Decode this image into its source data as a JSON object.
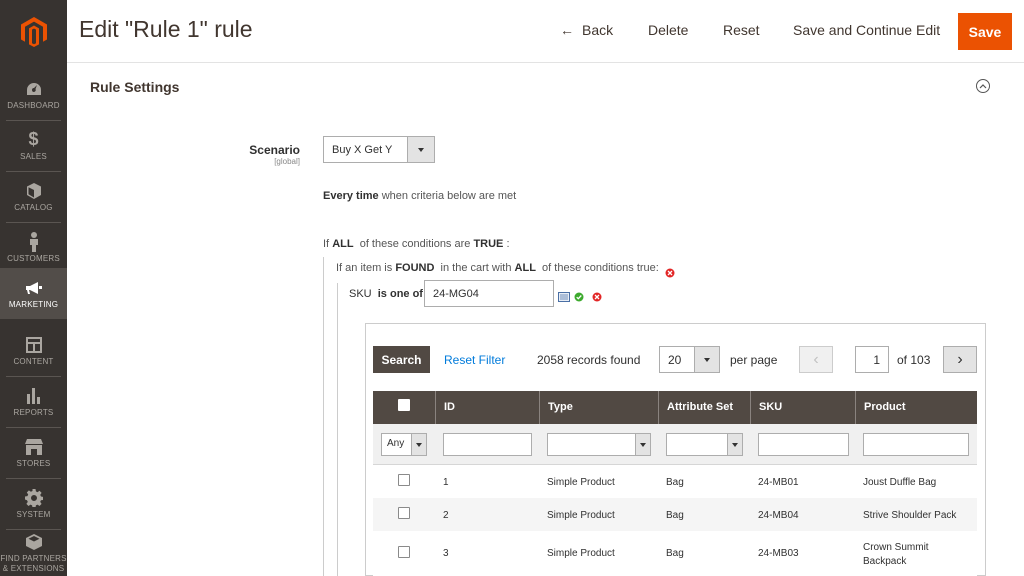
{
  "sidebar": {
    "items": [
      {
        "label": "DASHBOARD",
        "icon": "dashboard-icon"
      },
      {
        "label": "SALES",
        "icon": "dollar-icon"
      },
      {
        "label": "CATALOG",
        "icon": "box-icon"
      },
      {
        "label": "CUSTOMERS",
        "icon": "person-icon"
      },
      {
        "label": "MARKETING",
        "icon": "megaphone-icon"
      },
      {
        "label": "CONTENT",
        "icon": "layout-icon"
      },
      {
        "label": "REPORTS",
        "icon": "bar-chart-icon"
      },
      {
        "label": "STORES",
        "icon": "store-icon"
      },
      {
        "label": "SYSTEM",
        "icon": "gear-icon"
      },
      {
        "label": "FIND PARTNERS & EXTENSIONS",
        "icon": "extensions-icon"
      }
    ],
    "active": "MARKETING"
  },
  "header": {
    "title": "Edit \"Rule 1\" rule",
    "back_label": "Back",
    "delete_label": "Delete",
    "reset_label": "Reset",
    "save_continue_label": "Save and Continue Edit",
    "save_label": "Save"
  },
  "section": {
    "title": "Rule Settings",
    "scenario_label": "Scenario",
    "scenario_scope": "[global]",
    "scenario_value": "Buy X Get Y",
    "every_time_bold": "Every time",
    "every_time_rest": "when criteria below are met",
    "cond_if": "If",
    "cond_all": "ALL",
    "cond_mid": "of these conditions are",
    "cond_true": "TRUE",
    "cond_colon": ":",
    "found_pre": "If an item is",
    "found_bold": "FOUND",
    "found_mid": "in the cart with",
    "found_all": "ALL",
    "found_post": "of these conditions true:",
    "sku_label": "SKU",
    "sku_op": "is one of",
    "sku_value": "24-MG04"
  },
  "grid": {
    "search_label": "Search",
    "reset_filter_label": "Reset Filter",
    "records_found": "2058 records found",
    "per_page_value": "20",
    "per_page_label": "per page",
    "page_value": "1",
    "page_of": "of 103",
    "columns": [
      "ID",
      "Type",
      "Attribute Set",
      "SKU",
      "Product"
    ],
    "filter_any": "Any",
    "rows": [
      {
        "id": "1",
        "type": "Simple Product",
        "attr_set": "Bag",
        "sku": "24-MB01",
        "product": "Joust Duffle Bag"
      },
      {
        "id": "2",
        "type": "Simple Product",
        "attr_set": "Bag",
        "sku": "24-MB04",
        "product": "Strive Shoulder Pack"
      },
      {
        "id": "3",
        "type": "Simple Product",
        "attr_set": "Bag",
        "sku": "24-MB03",
        "product": "Crown Summit Backpack"
      }
    ]
  },
  "colors": {
    "sidebar_bg": "#373330",
    "accent": "#eb5202",
    "grid_header": "#514943",
    "link": "#007bdb"
  }
}
